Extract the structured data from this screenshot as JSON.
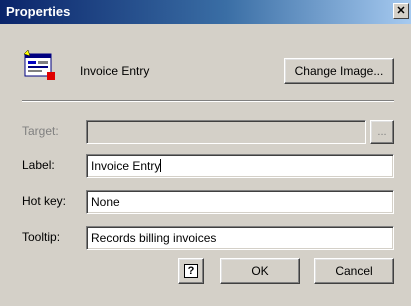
{
  "window": {
    "title": "Properties",
    "close_glyph": "✕",
    "title_color": "#0a246a",
    "background": "#d4d0c8"
  },
  "image_section": {
    "icon": "invoice-entry-icon",
    "label": "Invoice Entry",
    "change_button": "Change Image..."
  },
  "form": {
    "target": {
      "label": "Target:",
      "value": "",
      "disabled": true,
      "browse_label": "..."
    },
    "label_field": {
      "label": "Label:",
      "value": "Invoice Entry"
    },
    "hotkey": {
      "label": "Hot key:",
      "value": "None"
    },
    "tooltip": {
      "label": "Tooltip:",
      "value": "Records billing invoices"
    }
  },
  "buttons": {
    "help_icon": "help-icon",
    "help_glyph": "?",
    "ok": "OK",
    "cancel": "Cancel"
  }
}
